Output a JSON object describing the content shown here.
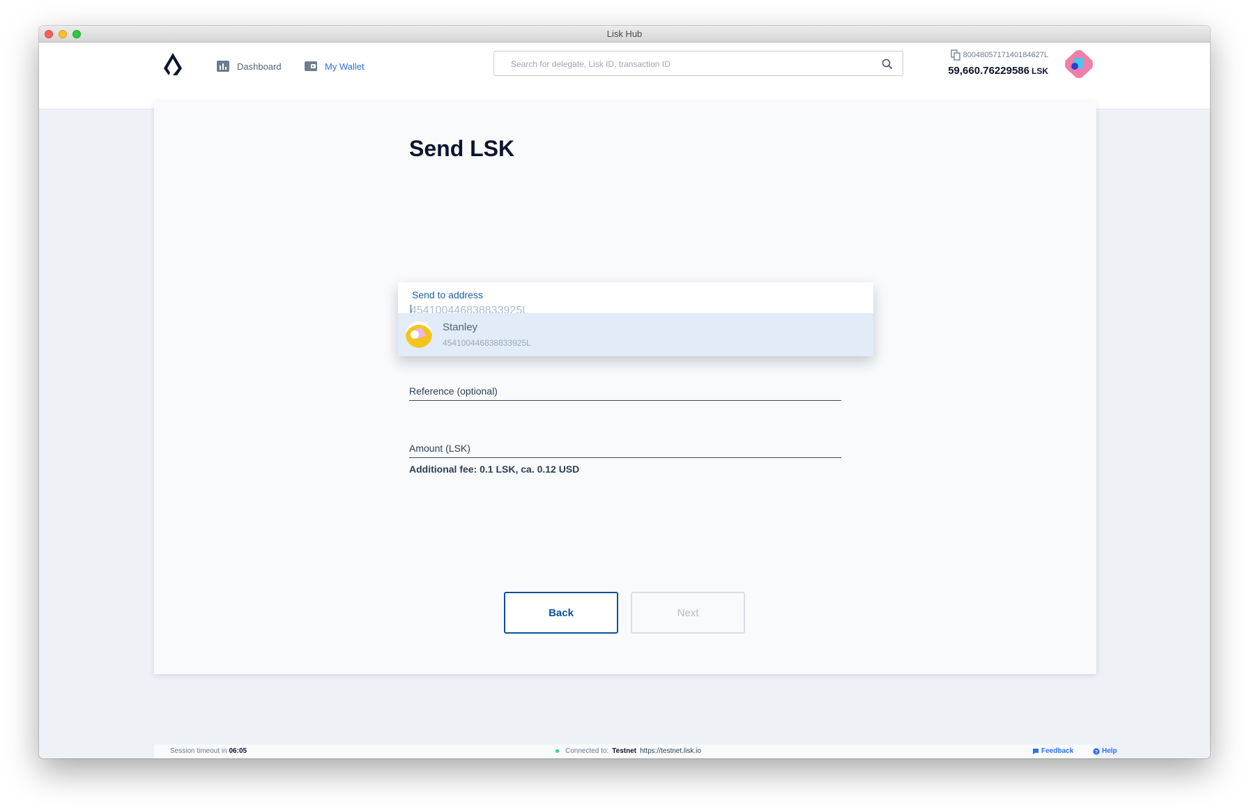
{
  "window": {
    "title": "Lisk Hub"
  },
  "nav": {
    "dashboard_label": "Dashboard",
    "wallet_label": "My Wallet"
  },
  "search": {
    "placeholder": "Search for delegate, Lisk ID, transaction ID"
  },
  "account": {
    "address": "8004805717140184627L",
    "balance": "59,660.76229586",
    "unit": "LSK"
  },
  "form": {
    "title": "Send LSK",
    "recipient": {
      "label": "Send to address",
      "placeholder": "454100446838833925L",
      "suggestion": {
        "name": "Stanley",
        "address": "454100446838833925L"
      }
    },
    "reference_label": "Reference (optional)",
    "amount_label": "Amount (LSK)",
    "fee_text": "Additional fee: 0.1 LSK, ca. 0.12 USD",
    "back_label": "Back",
    "next_label": "Next"
  },
  "footer": {
    "session_prefix": "Session timeout in",
    "session_time": "06:05",
    "connected_label": "Connected to:",
    "network": "Testnet",
    "node_url": "https://testnet.lisk.io",
    "feedback_label": "Feedback",
    "help_label": "Help"
  },
  "colors": {
    "accent": "#2d6fe8",
    "primary_dark": "#0c152e",
    "back_button": "#0b4f9c",
    "status_online": "#2bd67b"
  },
  "icons": [
    "lisk-logo-icon",
    "dashboard-icon",
    "wallet-icon",
    "search-icon",
    "copy-icon",
    "feedback-icon",
    "help-icon"
  ]
}
